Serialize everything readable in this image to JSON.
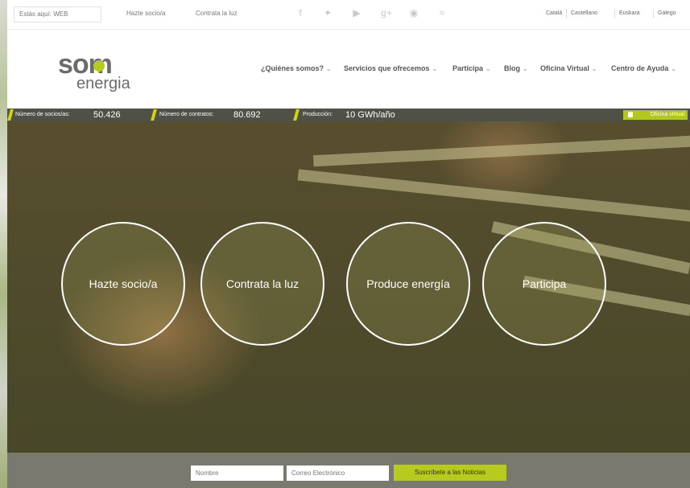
{
  "breadcrumb": "Estás aquí: WEB",
  "top_links": [
    "Hazte socio/a",
    "Contrata la luz"
  ],
  "social_icons": [
    "facebook-icon",
    "twitter-icon",
    "youtube-icon",
    "google-plus-icon",
    "flickr-icon",
    "rss-icon"
  ],
  "languages": [
    "Català",
    "Castellano",
    "Euskara",
    "Galego"
  ],
  "logo": {
    "brand_top": "som",
    "brand_bottom": "energia"
  },
  "nav": [
    "¿Quiénes somos?",
    "Servicios que ofrecemos",
    "Participa",
    "Blog",
    "Oficina Virtual",
    "Centro de Ayuda"
  ],
  "stats": [
    {
      "label": "Número de socios/as:",
      "value": "50.426"
    },
    {
      "label": "Número de contratos:",
      "value": "80.692"
    },
    {
      "label": "Producción:",
      "value": "10 GWh/año"
    }
  ],
  "office_button": "Oficina virtual",
  "hero_circles": [
    "Hazte socio/a",
    "Contrata la luz",
    "Produce energía",
    "Participa"
  ],
  "newsletter": {
    "name_placeholder": "Nombre",
    "email_placeholder": "Correo Electrónico",
    "subscribe_label": "Suscríbete a las Noticias"
  },
  "colors": {
    "accent": "#b6cb1e",
    "stats_bar": "#4f5046",
    "footer": "#79796f"
  }
}
